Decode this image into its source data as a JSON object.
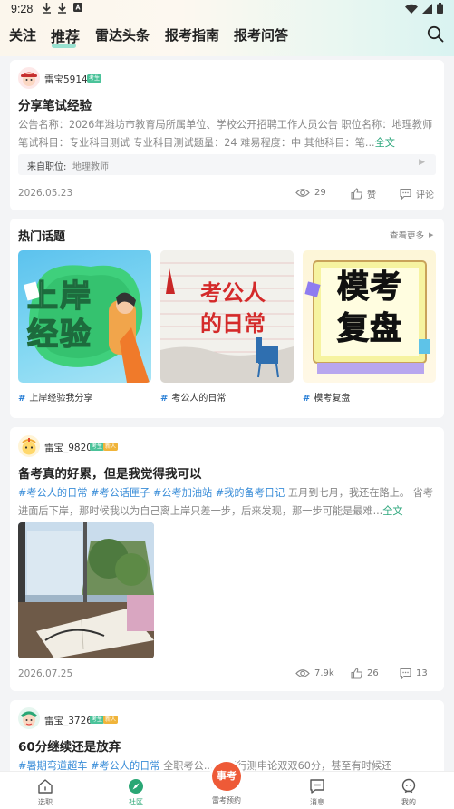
{
  "status_bar": {
    "time": "9:28"
  },
  "nav": {
    "tabs": [
      {
        "label": "关注"
      },
      {
        "label": "推荐"
      },
      {
        "label": "雷达头条"
      },
      {
        "label": "报考指南"
      },
      {
        "label": "报考问答"
      }
    ],
    "active_tab": "推荐"
  },
  "post1": {
    "username": "雷宝5914",
    "badge": "考生",
    "title": "分享笔试经验",
    "body": "公告名称：2026年潍坊市教育局所属单位、学校公开招聘工作人员公告 职位名称：地理教师 笔试科目：专业科目测试 专业科目测试题量：24 难易程度：中 其他科目：笔...",
    "more": "全文",
    "source_label": "来自职位:",
    "source_value": "地理教师",
    "date": "2026.05.23",
    "views": "29",
    "like_label": "赞",
    "comment_label": "评论"
  },
  "hot_topics": {
    "title": "热门话题",
    "more": "查看更多",
    "items": [
      {
        "label": "上岸经验我分享",
        "image_text": "上岸经验"
      },
      {
        "label": "考公人的日常",
        "image_text": "考公人的日常"
      },
      {
        "label": "模考复盘",
        "image_text": "模考复盘"
      }
    ]
  },
  "post2": {
    "username": "雷宝_9820",
    "badge": "考生",
    "badge2": "新人",
    "title": "备考真的好累，但是我觉得我可以",
    "tags": [
      "#考公人的日常",
      "#考公话匣子",
      "#公考加油站",
      "#我的备考日记"
    ],
    "body": " 五月到七月，我还在路上。 省考进面后下岸，那时候我以为自己离上岸只差一步，后来发现，那一步可能是最难...",
    "more": "全文",
    "date": "2026.07.25",
    "views": "7.9k",
    "likes": "26",
    "comments": "13"
  },
  "post3": {
    "username": "雷宝_3726",
    "badge": "考生",
    "badge2": "新人",
    "title": "60分继续还是放弃",
    "tags": [
      "#暑期弯道超车",
      "#考公人的日常"
    ],
    "body": " 全职考公... 省考行测申论双双60分，甚至有时候还"
  },
  "bottom_bar": {
    "items": [
      {
        "label": "选职"
      },
      {
        "label": "社区"
      },
      {
        "label": "雷考预约"
      },
      {
        "label": "消息"
      },
      {
        "label": "我的"
      }
    ],
    "center_button": "事考",
    "active": "社区"
  },
  "colors": {
    "accent_green": "#2ea77d",
    "tag_blue": "#3a8dd8",
    "center_red": "#ee5a37"
  }
}
